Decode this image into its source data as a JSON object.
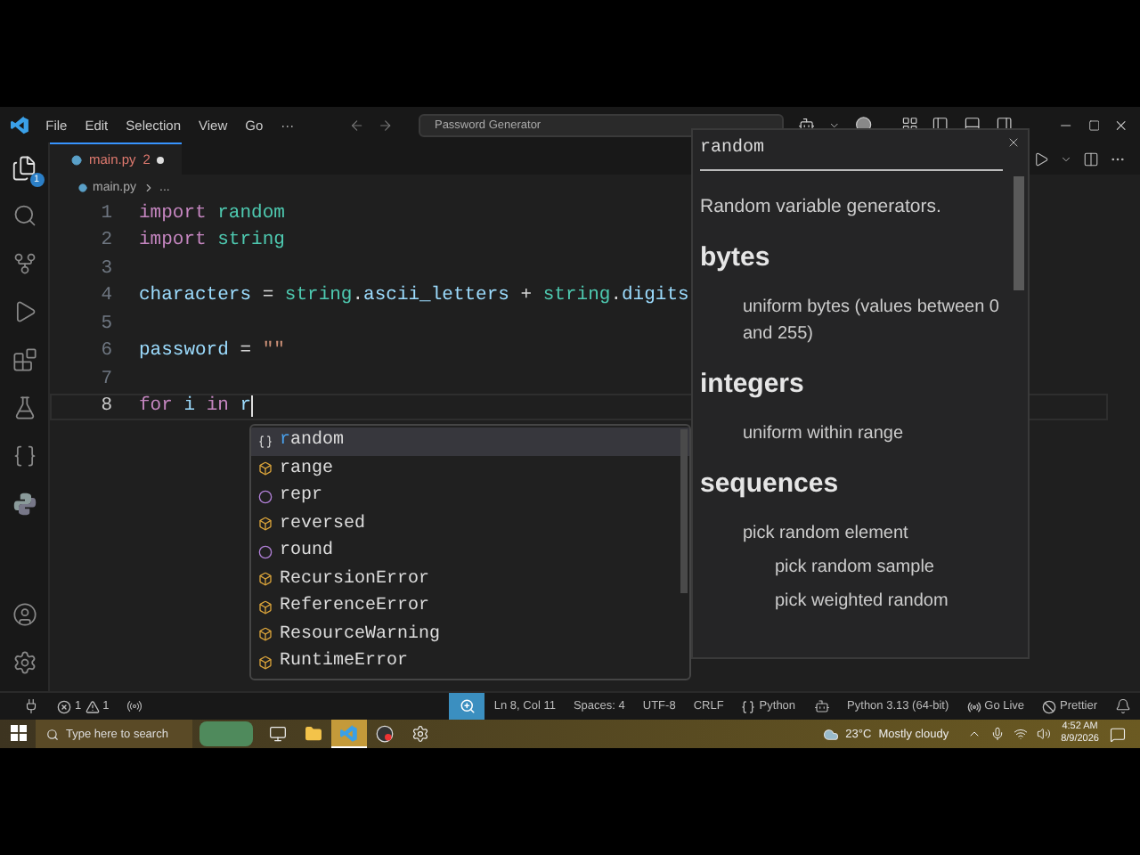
{
  "title_bar": {
    "menus": [
      "File",
      "Edit",
      "Selection",
      "View",
      "Go",
      "···"
    ],
    "search": "Password Generator"
  },
  "activity_bar": {
    "items": [
      {
        "kind": "files",
        "selected": true,
        "badge": "1"
      },
      {
        "kind": "search",
        "selected": false
      },
      {
        "kind": "source-control",
        "selected": false
      },
      {
        "kind": "run",
        "selected": false
      },
      {
        "kind": "extensions",
        "selected": false
      },
      {
        "kind": "testing",
        "selected": false
      },
      {
        "kind": "json",
        "selected": false
      },
      {
        "kind": "python",
        "selected": false
      }
    ],
    "bottom": [
      {
        "kind": "account"
      },
      {
        "kind": "settings"
      }
    ]
  },
  "tabs": [
    {
      "label": "main.py",
      "problems": "2",
      "modified": true,
      "selected": true
    }
  ],
  "breadcrumb": [
    "main.py",
    "..."
  ],
  "code": [
    {
      "number": "1",
      "current": false,
      "tokens": [
        {
          "kind": "keyword",
          "text": "import"
        },
        {
          "kind": "module",
          "text": "random",
          "space": true
        }
      ]
    },
    {
      "number": "2",
      "current": false,
      "tokens": [
        {
          "kind": "keyword",
          "text": "import"
        },
        {
          "kind": "module",
          "text": "string",
          "space": true
        }
      ]
    },
    {
      "number": "3",
      "current": false
    },
    {
      "number": "4",
      "current": false,
      "tokens": [
        {
          "kind": "variable",
          "text": "characters"
        },
        {
          "kind": "plain",
          "text": "=",
          "space": true
        },
        {
          "kind": "module",
          "text": "string",
          "space": true
        },
        {
          "kind": "plain",
          "text": "."
        },
        {
          "kind": "variable",
          "text": "ascii_letters"
        },
        {
          "kind": "plain",
          "text": "+",
          "space": true
        },
        {
          "kind": "module",
          "text": "string",
          "space": true
        },
        {
          "kind": "plain",
          "text": "."
        },
        {
          "kind": "variable",
          "text": "digits"
        }
      ]
    },
    {
      "number": "5",
      "current": false
    },
    {
      "number": "6",
      "current": false,
      "tokens": [
        {
          "kind": "variable",
          "text": "password"
        },
        {
          "kind": "plain",
          "text": "=",
          "space": true
        },
        {
          "kind": "string",
          "text": "\"\"",
          "space": true
        }
      ]
    },
    {
      "number": "7",
      "current": false
    },
    {
      "number": "8",
      "current": true,
      "tokens": [
        {
          "kind": "keyword",
          "text": "for"
        },
        {
          "kind": "variable",
          "text": "i",
          "space": true
        },
        {
          "kind": "keyword",
          "text": "in",
          "space": true
        },
        {
          "kind": "variable",
          "text": "r",
          "space": true
        }
      ]
    }
  ],
  "suggestions": [
    {
      "kind": "module",
      "match": "r",
      "rest": "andom",
      "selected": true
    },
    {
      "kind": "class",
      "rest": "range",
      "selected": false
    },
    {
      "kind": "function",
      "rest": "repr",
      "selected": false
    },
    {
      "kind": "class",
      "rest": "reversed",
      "selected": false
    },
    {
      "kind": "function",
      "rest": "round",
      "selected": false
    },
    {
      "kind": "class",
      "rest": "RecursionError",
      "selected": false
    },
    {
      "kind": "class",
      "rest": "ReferenceError",
      "selected": false
    },
    {
      "kind": "class",
      "rest": "ResourceWarning",
      "selected": false
    },
    {
      "kind": "class",
      "rest": "RuntimeError",
      "selected": false
    }
  ],
  "hover": {
    "title": "random",
    "summary": "Random variable generators.",
    "sections": [
      {
        "heading": "bytes",
        "items": [
          {
            "text": "uniform bytes (values between 0 and 255)"
          }
        ]
      },
      {
        "heading": "integers",
        "items": [
          {
            "text": "uniform within range"
          }
        ]
      },
      {
        "heading": "sequences",
        "items": [
          {
            "text": "pick random element",
            "children": [
              {
                "text": "pick random sample"
              },
              {
                "text": "pick weighted random"
              }
            ]
          }
        ]
      }
    ]
  },
  "status_bar": {
    "left": [
      {
        "kind": "remote"
      },
      {
        "kind": "problems",
        "errors": "1",
        "warnings": "1"
      },
      {
        "kind": "ports"
      }
    ],
    "right": [
      {
        "kind": "zoom"
      },
      {
        "kind": "text",
        "text": "Ln 8, Col 11"
      },
      {
        "kind": "text",
        "text": "Spaces: 4"
      },
      {
        "kind": "text",
        "text": "UTF-8"
      },
      {
        "kind": "text",
        "text": "CRLF"
      },
      {
        "kind": "language",
        "text": "Python"
      },
      {
        "kind": "copilot"
      },
      {
        "kind": "text",
        "text": "Python 3.13 (64-bit)"
      },
      {
        "kind": "live",
        "text": "Go Live"
      },
      {
        "kind": "prettier",
        "text": "Prettier"
      },
      {
        "kind": "bell"
      }
    ]
  },
  "taskbar": {
    "search_placeholder": "Type here to search",
    "apps": [
      {
        "kind": "photo",
        "selected": false
      },
      {
        "kind": "task-view",
        "selected": false
      },
      {
        "kind": "folder",
        "selected": false
      },
      {
        "kind": "code",
        "selected": true
      },
      {
        "kind": "recorder",
        "selected": false
      },
      {
        "kind": "settings",
        "selected": false
      }
    ],
    "weather": {
      "temp": "23°C",
      "text": "Mostly cloudy"
    },
    "time": "4:52 AM",
    "date": "8/9/2026"
  }
}
